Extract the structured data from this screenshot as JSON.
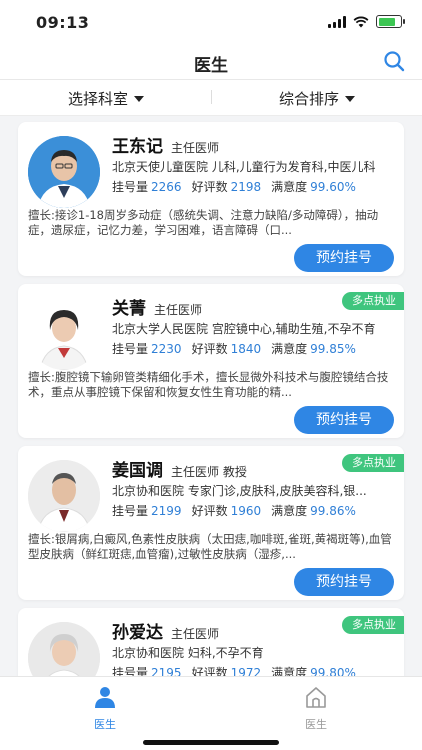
{
  "status_bar": {
    "time": "09:13"
  },
  "nav": {
    "title": "医生",
    "search_icon": "search-icon"
  },
  "filters": {
    "department": "选择科室",
    "sort": "综合排序"
  },
  "stats_labels": {
    "reg": "挂号量",
    "praise": "好评数",
    "satisfaction": "满意度"
  },
  "book_label": "预约挂号",
  "multi_practice_label": "多点执业",
  "doctors": [
    {
      "name": "王东记",
      "title": "主任医师",
      "hospital": "北京天使儿童医院  儿科,儿童行为发育科,中医儿科",
      "reg": "2266",
      "praise": "2198",
      "satisfaction": "99.60%",
      "specialty": "擅长:接诊1-18周岁多动症（感统失调、注意力缺陷/多动障碍），抽动症，遗尿症，记忆力差，学习困难，语言障碍（口...",
      "multi": false
    },
    {
      "name": "关菁",
      "title": "主任医师",
      "hospital": "北京大学人民医院  宫腔镜中心,辅助生殖,不孕不育",
      "reg": "2230",
      "praise": "1840",
      "satisfaction": "99.85%",
      "specialty": "擅长:腹腔镜下输卵管类精细化手术，擅长显微外科技术与腹腔镜结合技术，重点从事腔镜下保留和恢复女性生育功能的精...",
      "multi": true
    },
    {
      "name": "姜国调",
      "title": "主任医师 教授",
      "hospital": "北京协和医院  专家门诊,皮肤科,皮肤美容科,银...",
      "reg": "2199",
      "praise": "1960",
      "satisfaction": "99.86%",
      "specialty": "擅长:银屑病,白癜风,色素性皮肤病（太田痣,咖啡斑,雀斑,黄褐斑等),血管型皮肤病（鲜红斑痣,血管瘤),过敏性皮肤病（湿疹,...",
      "multi": true
    },
    {
      "name": "孙爱达",
      "title": "主任医师",
      "hospital": "北京协和医院  妇科,不孕不育",
      "reg": "2195",
      "praise": "1972",
      "satisfaction": "99.80%",
      "specialty": "",
      "multi": true
    }
  ],
  "tabs": [
    {
      "label": "医生",
      "icon": "doctor-icon",
      "active": true
    },
    {
      "label": "医生",
      "icon": "home-icon",
      "active": false
    }
  ],
  "colors": {
    "accent": "#2f86e4",
    "badge": "#3fc57e"
  }
}
